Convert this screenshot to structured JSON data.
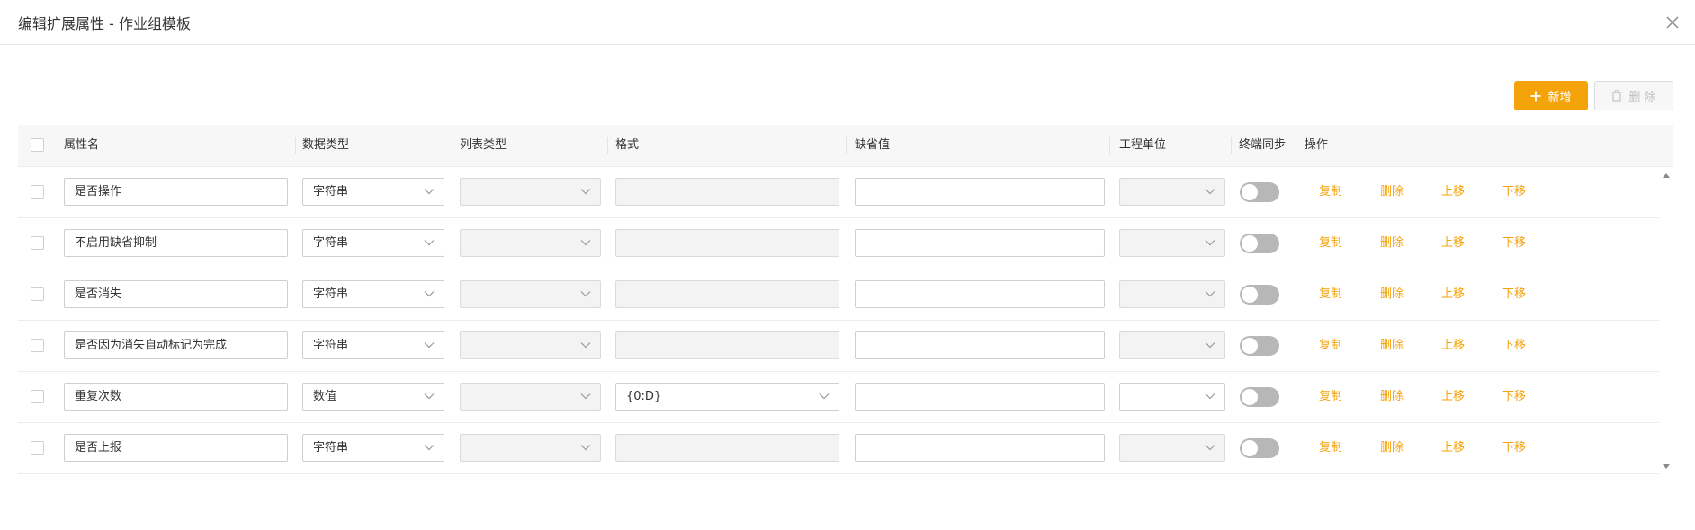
{
  "dialog": {
    "title": "编辑扩展属性 - 作业组模板"
  },
  "toolbar": {
    "add_label": "新增",
    "delete_label": "删 除"
  },
  "table": {
    "headers": [
      "属性名",
      "数据类型",
      "列表类型",
      "格式",
      "缺省值",
      "工程单位",
      "终端同步",
      "操作"
    ],
    "rows": [
      {
        "name": "是否操作",
        "data_type": "字符串",
        "list_type": "",
        "format": "",
        "format_enabled": false,
        "default": "",
        "unit": "",
        "unit_enabled": false,
        "sync": false
      },
      {
        "name": "不启用缺省抑制",
        "data_type": "字符串",
        "list_type": "",
        "format": "",
        "format_enabled": false,
        "default": "",
        "unit": "",
        "unit_enabled": false,
        "sync": false
      },
      {
        "name": "是否消失",
        "data_type": "字符串",
        "list_type": "",
        "format": "",
        "format_enabled": false,
        "default": "",
        "unit": "",
        "unit_enabled": false,
        "sync": false
      },
      {
        "name": "是否因为消失自动标记为完成",
        "data_type": "字符串",
        "list_type": "",
        "format": "",
        "format_enabled": false,
        "default": "",
        "unit": "",
        "unit_enabled": false,
        "sync": false
      },
      {
        "name": "重复次数",
        "data_type": "数值",
        "list_type": "",
        "format": "{0:D}",
        "format_enabled": true,
        "default": "",
        "unit": "",
        "unit_enabled": true,
        "sync": false
      },
      {
        "name": "是否上报",
        "data_type": "字符串",
        "list_type": "",
        "format": "",
        "format_enabled": false,
        "default": "",
        "unit": "",
        "unit_enabled": false,
        "sync": false
      }
    ],
    "actions": {
      "copy": "复制",
      "delete": "删除",
      "move_up": "上移",
      "move_down": "下移"
    }
  },
  "colors": {
    "accent": "#f5a30a",
    "toggle_off": "#b7b7b7"
  }
}
